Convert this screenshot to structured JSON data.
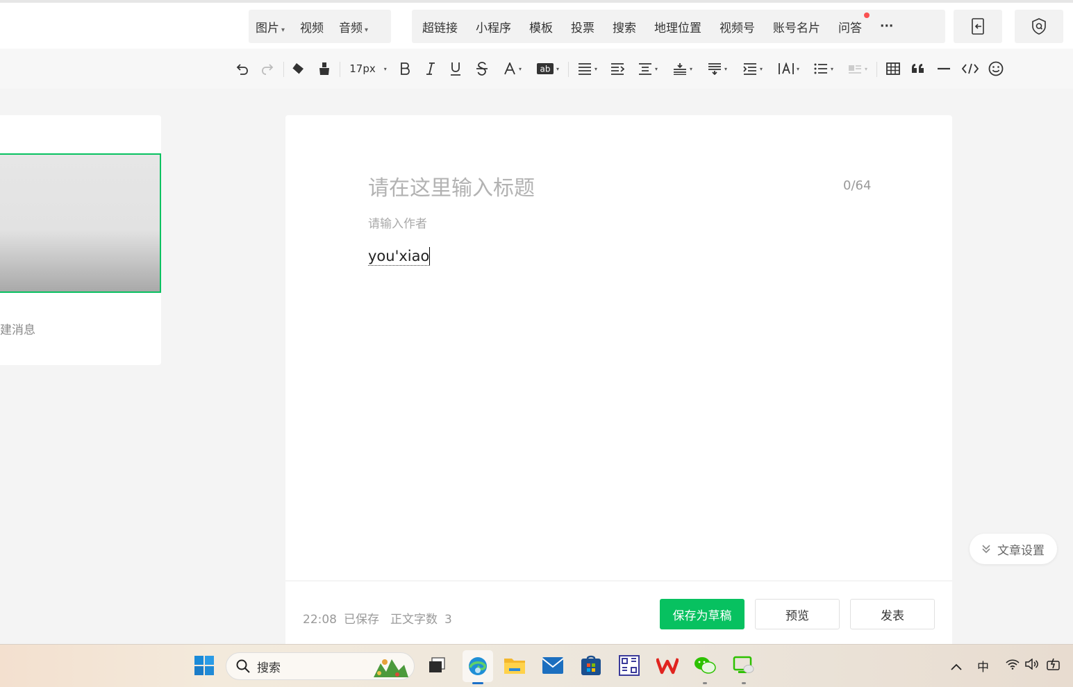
{
  "insert_bar": {
    "media": [
      {
        "label": "图片",
        "dropdown": true
      },
      {
        "label": "视频",
        "dropdown": false
      },
      {
        "label": "音频",
        "dropdown": true
      }
    ],
    "tools": [
      "超链接",
      "小程序",
      "模板",
      "投票",
      "搜索",
      "地理位置",
      "视频号",
      "账号名片",
      "问答"
    ],
    "more_label": "···"
  },
  "format_bar": {
    "font_size": "17px"
  },
  "left_panel": {
    "new_message_label": "建消息"
  },
  "editor": {
    "title_placeholder": "请在这里输入标题",
    "title_count": "0/64",
    "author_placeholder": "请输入作者",
    "body_text": "you'xiao"
  },
  "footer": {
    "time": "22:08",
    "saved_label": "已保存",
    "word_count_label": "正文字数",
    "word_count": "3",
    "save_draft_label": "保存为草稿",
    "preview_label": "预览",
    "publish_label": "发表"
  },
  "article_settings_label": "文章设置",
  "taskbar": {
    "search_label": "搜索",
    "ime_label": "中"
  },
  "colors": {
    "accent": "#07c160",
    "notify": "#fa5151"
  }
}
